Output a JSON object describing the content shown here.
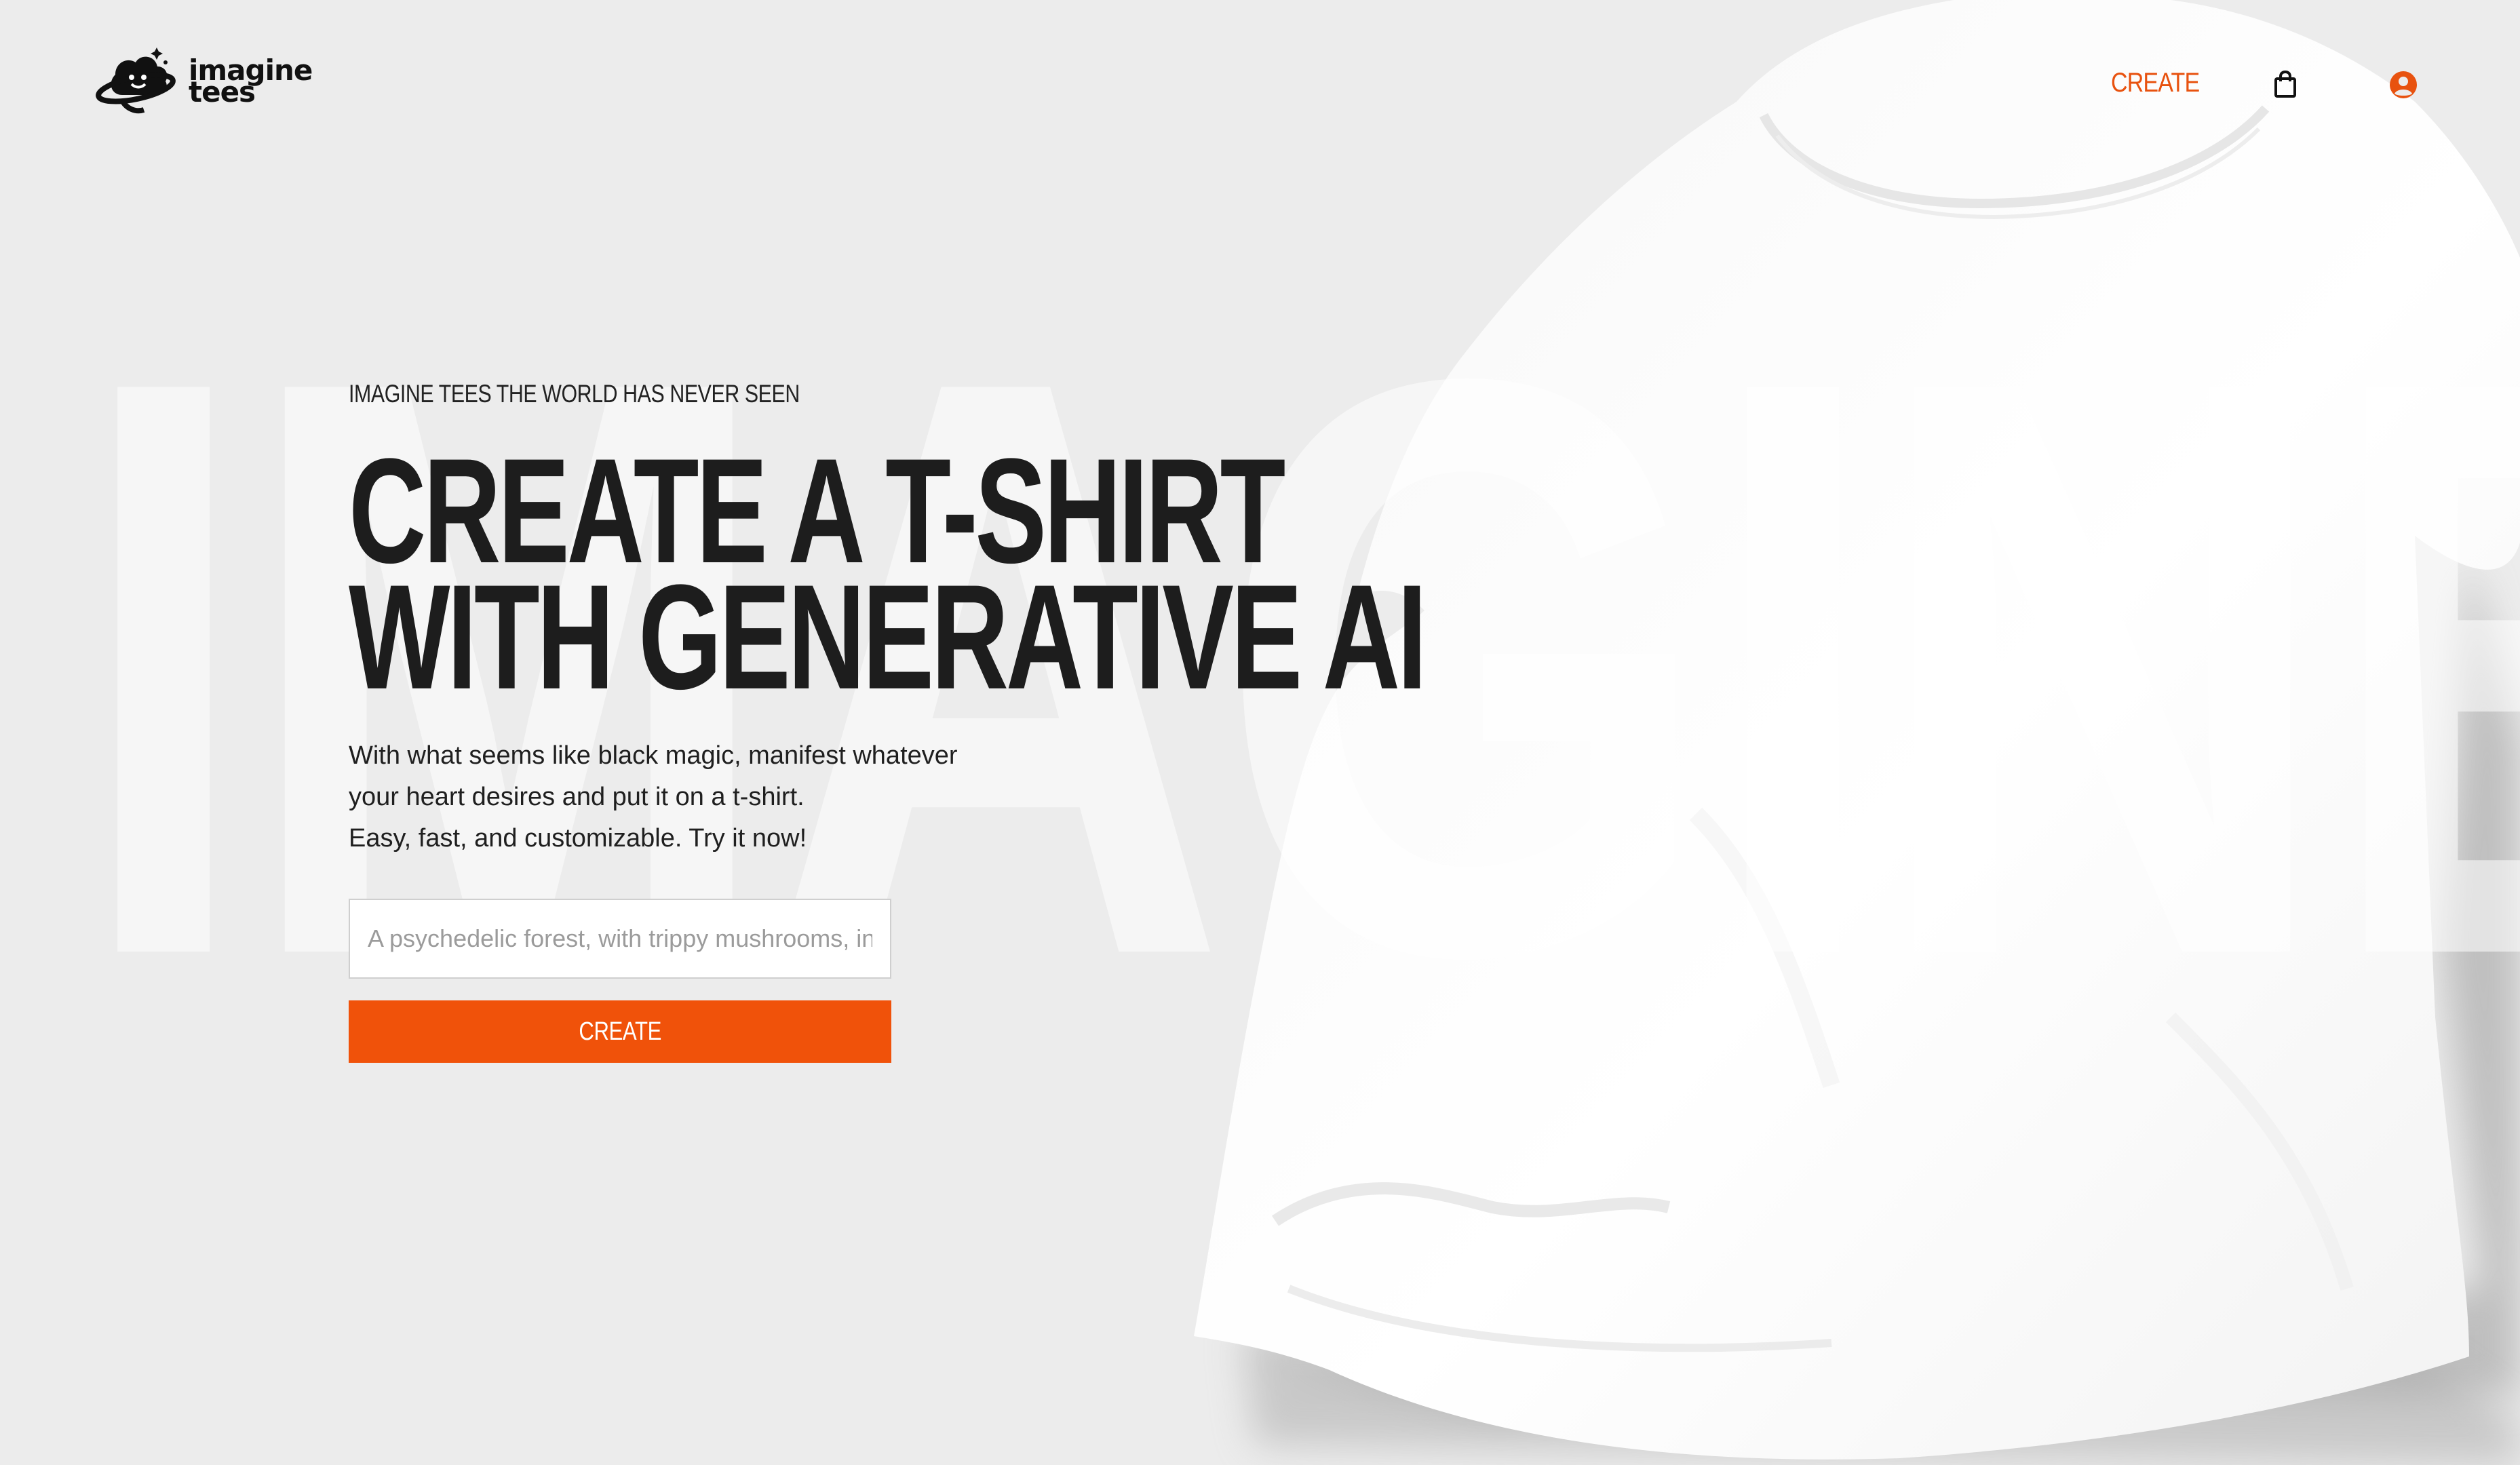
{
  "brand": {
    "name_line1": "imagine",
    "name_line2": "tees"
  },
  "nav": {
    "create_label": "CREATE",
    "cart_icon": "shopping-bag-icon",
    "account_icon": "user-circle-icon"
  },
  "watermark": "IMAGINE",
  "hero": {
    "eyebrow": "IMAGINE TEES THE WORLD HAS NEVER SEEN",
    "headline_line1": "CREATE A T-SHIRT",
    "headline_line2": "WITH GENERATIVE AI",
    "body_line1": "With what seems like black magic, manifest whatever",
    "body_line2": "your heart desires and put it on a t-shirt.",
    "body_line3": "Easy, fast, and customizable. Try it now!",
    "input_placeholder": "A psychedelic forest, with trippy mushrooms, in the style of a vintage poster",
    "input_value": "",
    "button_label": "CREATE"
  },
  "colors": {
    "accent": "#f0520a",
    "nav_accent": "#e8520f",
    "background": "#ececec",
    "text": "#1d1d1d"
  }
}
